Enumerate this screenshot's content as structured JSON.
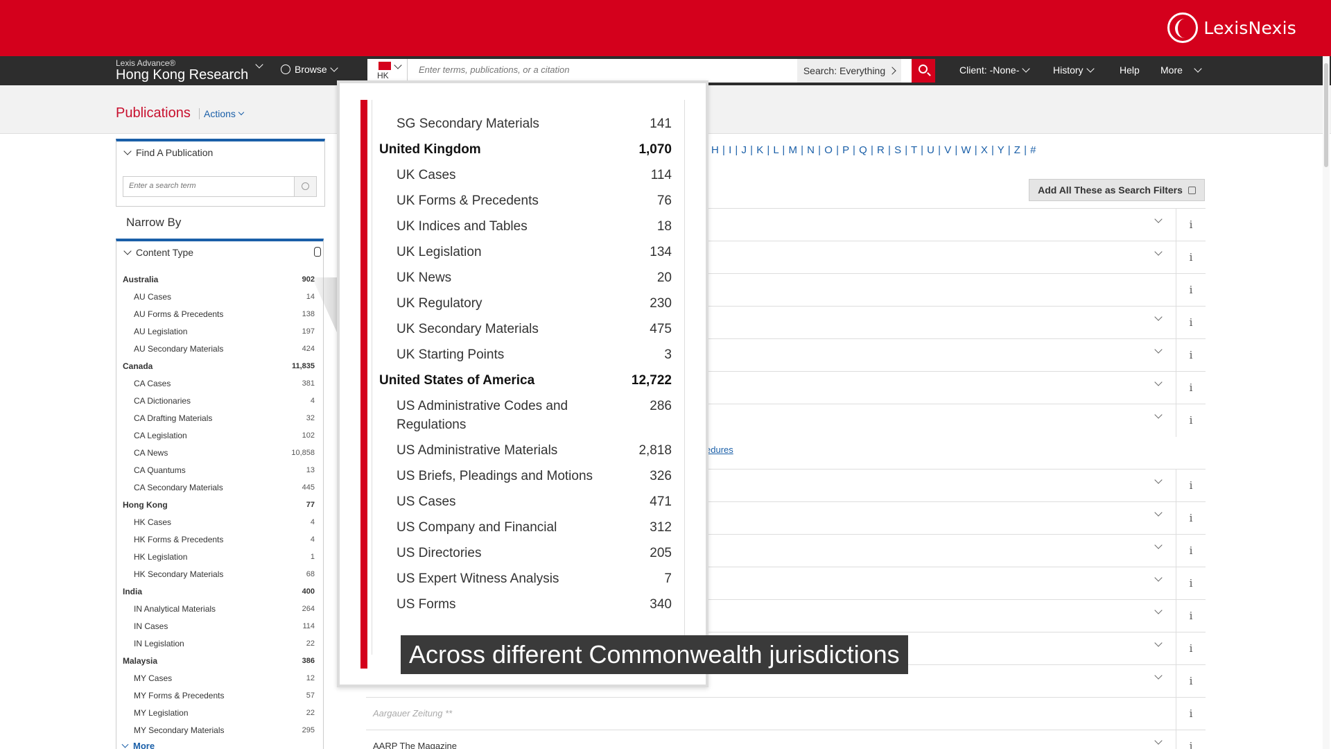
{
  "brand": {
    "name": "LexisNexis"
  },
  "nav": {
    "product_small": "Lexis Advance®",
    "product_big": "Hong Kong Research",
    "browse": "Browse",
    "flag_code": "HK",
    "search_placeholder": "Enter terms, publications, or a citation",
    "search_scope": "Search: Everything",
    "client": "Client: -None-",
    "history": "History",
    "help": "Help",
    "more": "More"
  },
  "subheader": {
    "title": "Publications",
    "actions": "Actions"
  },
  "sidebar": {
    "find_title": "Find A Publication",
    "find_placeholder": "Enter a search term",
    "narrow_by": "Narrow By",
    "content_type": "Content Type",
    "more": "More",
    "facets": [
      {
        "label": "Australia",
        "count": "902",
        "group": true
      },
      {
        "label": "AU Cases",
        "count": "14"
      },
      {
        "label": "AU Forms & Precedents",
        "count": "138"
      },
      {
        "label": "AU Legislation",
        "count": "197"
      },
      {
        "label": "AU Secondary Materials",
        "count": "424"
      },
      {
        "label": "Canada",
        "count": "11,835",
        "group": true
      },
      {
        "label": "CA Cases",
        "count": "381"
      },
      {
        "label": "CA Dictionaries",
        "count": "4"
      },
      {
        "label": "CA Drafting Materials",
        "count": "32"
      },
      {
        "label": "CA Legislation",
        "count": "102"
      },
      {
        "label": "CA News",
        "count": "10,858"
      },
      {
        "label": "CA Quantums",
        "count": "13"
      },
      {
        "label": "CA Secondary Materials",
        "count": "445"
      },
      {
        "label": "Hong Kong",
        "count": "77",
        "group": true
      },
      {
        "label": "HK Cases",
        "count": "4"
      },
      {
        "label": "HK Forms & Precedents",
        "count": "4"
      },
      {
        "label": "HK Legislation",
        "count": "1"
      },
      {
        "label": "HK Secondary Materials",
        "count": "68"
      },
      {
        "label": "India",
        "count": "400",
        "group": true
      },
      {
        "label": "IN Analytical Materials",
        "count": "264"
      },
      {
        "label": "IN Cases",
        "count": "114"
      },
      {
        "label": "IN Legislation",
        "count": "22"
      },
      {
        "label": "Malaysia",
        "count": "386",
        "group": true
      },
      {
        "label": "MY Cases",
        "count": "12"
      },
      {
        "label": "MY Forms & Precedents",
        "count": "57"
      },
      {
        "label": "MY Legislation",
        "count": "22"
      },
      {
        "label": "MY Secondary Materials",
        "count": "295"
      }
    ]
  },
  "main": {
    "alphabet": "H | I | J | K | L | M | N | O | P | Q | R | S | T | U | V | W | X | Y | Z | #",
    "add_all": "Add All These as Search Filters",
    "partial_link": "edures",
    "row_titles": [
      "Aargauer Zeitung **",
      "AARP The Magazine"
    ],
    "info_glyph": "i"
  },
  "zoom": {
    "items": [
      {
        "label": "SG Secondary Materials",
        "count": "141"
      },
      {
        "label": "United Kingdom",
        "count": "1,070",
        "group": true
      },
      {
        "label": "UK Cases",
        "count": "114"
      },
      {
        "label": "UK Forms & Precedents",
        "count": "76"
      },
      {
        "label": "UK Indices and Tables",
        "count": "18"
      },
      {
        "label": "UK Legislation",
        "count": "134"
      },
      {
        "label": "UK News",
        "count": "20"
      },
      {
        "label": "UK Regulatory",
        "count": "230"
      },
      {
        "label": "UK Secondary Materials",
        "count": "475"
      },
      {
        "label": "UK Starting Points",
        "count": "3"
      },
      {
        "label": "United States of America",
        "count": "12,722",
        "group": true
      },
      {
        "label": "US Administrative Codes and Regulations",
        "count": "286"
      },
      {
        "label": "US Administrative Materials",
        "count": "2,818"
      },
      {
        "label": "US Briefs, Pleadings and Motions",
        "count": "326"
      },
      {
        "label": "US Cases",
        "count": "471"
      },
      {
        "label": "US Company and Financial",
        "count": "312"
      },
      {
        "label": "US Directories",
        "count": "205"
      },
      {
        "label": "US Expert Witness Analysis",
        "count": "7"
      },
      {
        "label": "US Forms",
        "count": "340"
      }
    ]
  },
  "caption": "Across different Commonwealth jurisdictions",
  "colors": {
    "brand_red": "#d4001c",
    "nav_dark": "#2d2d2d",
    "link_blue": "#1a5fa8"
  }
}
